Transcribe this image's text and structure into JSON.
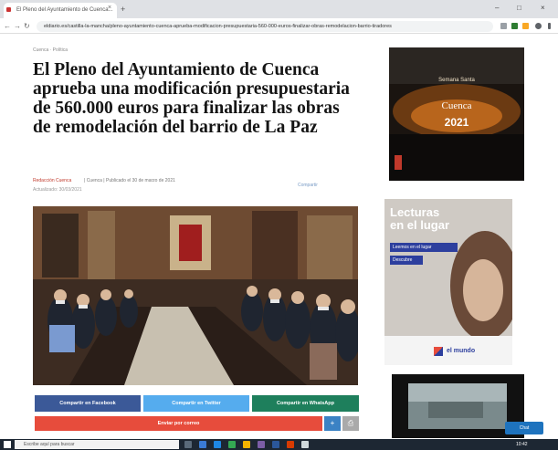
{
  "browser": {
    "tab_title": "El Pleno del Ayuntamiento de Cuenca...",
    "tab_close": "×",
    "new_tab": "+",
    "window_controls": [
      "–",
      "□",
      "×"
    ],
    "nav": [
      "←",
      "→",
      "↻"
    ],
    "url": "eldiario.es/castilla-la-mancha/pleno-ayuntamiento-cuenca-aprueba-modificacion-presupuestaria-560-000-euros-finalizar-obras-remodelacion-barrio-tiradores"
  },
  "article": {
    "breadcrumb": "Cuenca · Política",
    "headline": "El Pleno del Ayuntamiento de Cuenca aprueba una modificación presupuestaria de 560.000 euros para finalizar las obras de remodelación del barrio de La Paz",
    "byline_author": "Redacción Cuenca",
    "byline_rest": "| Cuenca | Publicado el 30 de marzo de 2021",
    "dateline": "Actualizado: 30/03/2021",
    "share_small": "Compartir"
  },
  "share": {
    "facebook": "Compartir en Facebook",
    "twitter": "Compartir en Twitter",
    "whatsapp": "Compartir en WhatsApp",
    "email": "Enviar por correo",
    "more": "+",
    "print": "⎙"
  },
  "ads": {
    "ad1_line1": "Semana Santa",
    "ad1_line2": "Cuenca",
    "ad1_year": "2021",
    "ad2_title_1": "Lecturas",
    "ad2_title_2": "en el lugar",
    "ad2_tag1": "Leemos en el lugar",
    "ad2_tag2": "Descubre",
    "ad2_brand": "el mundo",
    "chat": "Chat"
  },
  "taskbar": {
    "search": "Escribe aquí para buscar",
    "clock": "10:42"
  }
}
